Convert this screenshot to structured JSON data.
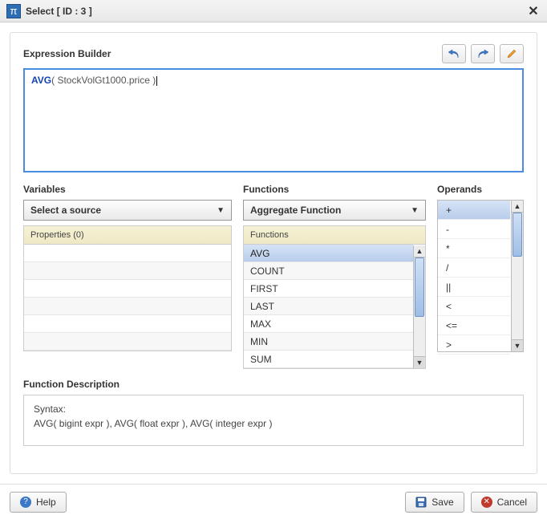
{
  "titlebar": {
    "pi_glyph": "π",
    "title": "Select [ ID : 3 ]"
  },
  "builder": {
    "heading": "Expression Builder",
    "expression_fn": "AVG",
    "expression_open": "( ",
    "expression_arg": "StockVolGt1000.price",
    "expression_close": " )"
  },
  "variables": {
    "heading": "Variables",
    "dropdown_label": "Select a source",
    "list_header": "Properties (0)",
    "rows": [
      "",
      "",
      "",
      "",
      "",
      ""
    ]
  },
  "functions": {
    "heading": "Functions",
    "dropdown_label": "Aggregate Function",
    "list_header": "Functions",
    "items": [
      "AVG",
      "COUNT",
      "FIRST",
      "LAST",
      "MAX",
      "MIN",
      "SUM"
    ],
    "selected_index": 0
  },
  "operands": {
    "heading": "Operands",
    "items": [
      "+",
      "-",
      "*",
      "/",
      "||",
      "<",
      "<=",
      ">"
    ],
    "selected_index": 0
  },
  "description": {
    "section_heading": "Function Description",
    "syntax_label": "Syntax:",
    "syntax_text": "AVG( bigint expr ), AVG( float expr ), AVG( integer expr )"
  },
  "footer": {
    "help_label": "Help",
    "save_label": "Save",
    "cancel_label": "Cancel"
  }
}
